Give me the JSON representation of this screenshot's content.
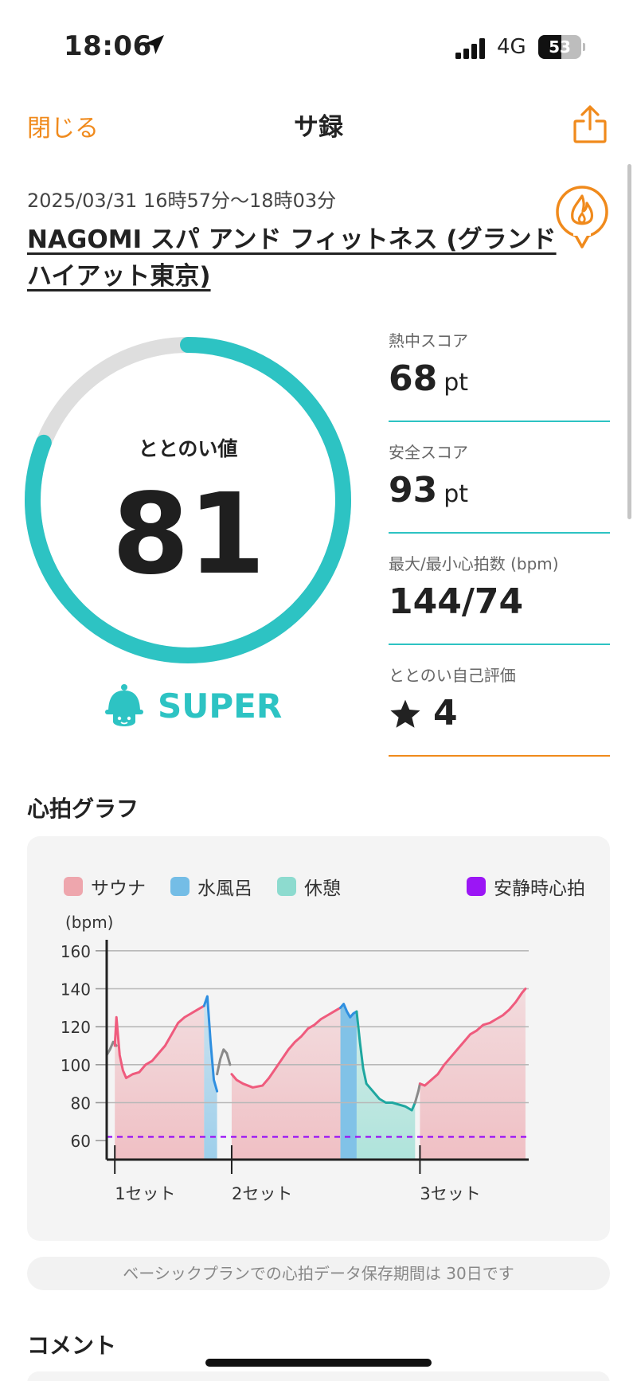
{
  "status_bar": {
    "time": "18:06",
    "network": "4G",
    "battery_level": 53,
    "battery_text": "53"
  },
  "nav": {
    "close_label": "閉じる",
    "title": "サ録",
    "share_icon": "share-icon"
  },
  "session": {
    "datetime": "2025/03/31 16時57分〜18時03分",
    "facility": "NAGOMI スパ アンド フィットネス (グランド ハイアット東京)"
  },
  "score": {
    "label": "ととのい値",
    "value": "81",
    "value_numeric": 81,
    "rank": "SUPER",
    "accent": "#2dc3c3"
  },
  "stats": [
    {
      "label": "熱中スコア",
      "value": "68",
      "unit": "pt"
    },
    {
      "label": "安全スコア",
      "value": "93",
      "unit": "pt"
    },
    {
      "label": "最大/最小心拍数 (bpm)",
      "value": "144/74",
      "unit": ""
    },
    {
      "label": "ととのい自己評価",
      "value": "4",
      "unit": ""
    }
  ],
  "graph": {
    "title": "心拍グラフ",
    "legend": [
      {
        "label": "サウナ",
        "color": "#eea6ad"
      },
      {
        "label": "水風呂",
        "color": "#74bde6"
      },
      {
        "label": "休憩",
        "color": "#8ddbcf"
      },
      {
        "label": "安静時心拍",
        "color": "#9b16f5"
      }
    ],
    "y_unit": "(bpm)",
    "note": "ベーシックプランでの心拍データ保存期間は 30日です"
  },
  "chart_data": {
    "type": "line",
    "y_ticks": [
      160,
      140,
      120,
      100,
      80,
      60
    ],
    "ylim": [
      50,
      170
    ],
    "x_labels": [
      {
        "label": "1セット",
        "x": 2.5
      },
      {
        "label": "2セット",
        "x": 38.5
      },
      {
        "label": "3セット",
        "x": 96.5
      }
    ],
    "xlim": [
      0,
      130
    ],
    "resting_heart_rate": 62,
    "phases": [
      {
        "type": "sauna",
        "start": 2.5,
        "end": 30
      },
      {
        "type": "cold",
        "start": 31,
        "end": 34
      },
      {
        "type": "sauna",
        "start": 38.5,
        "end": 72
      },
      {
        "type": "cold",
        "start": 75,
        "end": 77
      },
      {
        "type": "rest",
        "start": 77,
        "end": 95
      },
      {
        "type": "sauna",
        "start": 96.5,
        "end": 129
      }
    ],
    "series": [
      {
        "segment": "pre",
        "x": [
          0,
          1,
          2,
          3
        ],
        "y": [
          105,
          108,
          112,
          110
        ]
      },
      {
        "segment": "sauna",
        "x": [
          2.5,
          3,
          4,
          5,
          6,
          8,
          10,
          12,
          14,
          16,
          18,
          20,
          22,
          24,
          26,
          28,
          30
        ],
        "y": [
          110,
          125,
          105,
          97,
          93,
          95,
          96,
          100,
          102,
          106,
          110,
          116,
          122,
          125,
          127,
          129,
          131
        ]
      },
      {
        "segment": "cold",
        "x": [
          30,
          31,
          32,
          33,
          34
        ],
        "y": [
          131,
          136,
          112,
          92,
          86
        ]
      },
      {
        "segment": "transition",
        "x": [
          34,
          35,
          36,
          37,
          38
        ],
        "y": [
          95,
          103,
          108,
          106,
          100
        ]
      },
      {
        "segment": "sauna",
        "x": [
          38.5,
          40,
          42,
          45,
          48,
          50,
          52,
          54,
          56,
          58,
          60,
          62,
          64,
          66,
          68,
          70,
          72
        ],
        "y": [
          95,
          92,
          90,
          88,
          89,
          93,
          98,
          103,
          108,
          112,
          115,
          119,
          121,
          124,
          126,
          128,
          130
        ]
      },
      {
        "segment": "cold",
        "x": [
          72,
          73,
          74,
          75,
          76,
          77
        ],
        "y": [
          130,
          132,
          128,
          125,
          127,
          128
        ]
      },
      {
        "segment": "rest",
        "x": [
          77,
          78,
          79,
          80,
          82,
          84,
          86,
          88,
          90,
          92,
          94,
          95
        ],
        "y": [
          128,
          112,
          98,
          90,
          86,
          82,
          80,
          80,
          79,
          78,
          76,
          80
        ]
      },
      {
        "segment": "transition",
        "x": [
          95,
          96,
          96.5
        ],
        "y": [
          80,
          86,
          90
        ]
      },
      {
        "segment": "sauna",
        "x": [
          96.5,
          98,
          100,
          102,
          104,
          106,
          108,
          110,
          112,
          114,
          116,
          118,
          120,
          122,
          124,
          126,
          128,
          129
        ],
        "y": [
          90,
          89,
          92,
          95,
          100,
          104,
          108,
          112,
          116,
          118,
          121,
          122,
          124,
          126,
          129,
          133,
          138,
          140
        ]
      }
    ]
  }
}
